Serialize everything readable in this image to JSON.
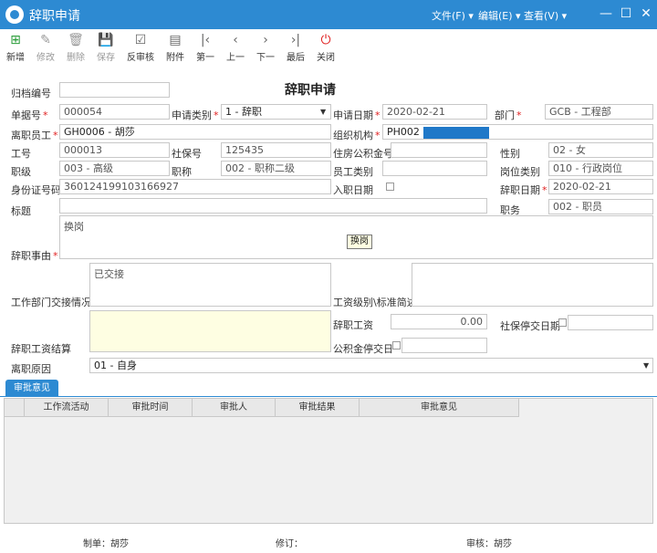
{
  "window": {
    "title": "辞职申请"
  },
  "menus": {
    "file": "文件(F)",
    "edit": "编辑(E)",
    "view": "查看(V)"
  },
  "toolbar": {
    "new": "新增",
    "edit": "修改",
    "delete": "删除",
    "save": "保存",
    "review": "反审核",
    "attach": "附件",
    "first": "第一",
    "prev": "上一",
    "next": "下一",
    "last": "最后",
    "close": "关闭"
  },
  "form": {
    "title": "辞职申请",
    "archive_no": {
      "label": "归档编号",
      "value": ""
    },
    "doc_no": {
      "label": "单据号",
      "value": "000054"
    },
    "apply_type": {
      "label": "申请类别",
      "value": "1 - 辞职"
    },
    "apply_date": {
      "label": "申请日期",
      "value": "2020-02-21"
    },
    "dept": {
      "label": "部门",
      "value": "GCB - 工程部"
    },
    "employee": {
      "label": "离职员工",
      "value": "GH0006 - 胡莎"
    },
    "org": {
      "label": "组织机构",
      "value": "PH002"
    },
    "emp_no": {
      "label": "工号",
      "value": "000013"
    },
    "social_no": {
      "label": "社保号",
      "value": "125435"
    },
    "housing_no": {
      "label": "住房公积金号",
      "value": ""
    },
    "gender": {
      "label": "性别",
      "value": "02 - 女"
    },
    "rank": {
      "label": "职级",
      "value": "003 - 高级"
    },
    "title_rank": {
      "label": "职称",
      "value": "002 - 职称二级"
    },
    "emp_category": {
      "label": "员工类别",
      "value": ""
    },
    "post_category": {
      "label": "岗位类别",
      "value": "010 - 行政岗位"
    },
    "id_card": {
      "label": "身份证号码",
      "value": "360124199103166927"
    },
    "entry_date": {
      "label": "入职日期",
      "value": ""
    },
    "resign_date": {
      "label": "辞职日期",
      "value": "2020-02-21"
    },
    "subject": {
      "label": "标题",
      "value": ""
    },
    "position": {
      "label": "职务",
      "value": "002 - 职员"
    },
    "reason": {
      "label": "辞职事由",
      "value": "换岗"
    },
    "tooltip": "换岗",
    "handover": {
      "label": "工作部门交接情况",
      "value": "已交接"
    },
    "salary_std": {
      "label": "工资级别\\标准简述",
      "value": ""
    },
    "resign_salary": {
      "label": "辞职工资",
      "value": "0.00"
    },
    "social_stop": {
      "label": "社保停交日期",
      "value": ""
    },
    "salary_settle": {
      "label": "辞职工资结算",
      "value": ""
    },
    "housing_stop": {
      "label": "公积金停交日",
      "value": ""
    },
    "leave_reason": {
      "label": "离职原因",
      "value": "01 - 自身"
    }
  },
  "approval": {
    "tab": "审批意见",
    "columns": [
      "工作流活动",
      "审批时间",
      "审批人",
      "审批结果",
      "审批意见"
    ]
  },
  "footer": {
    "maker": "制单：胡莎",
    "revise": "修订：",
    "auditor": "审核：胡莎"
  },
  "colors": {
    "accent": "#2d8ad2",
    "required": "#e02020",
    "highlight": "#fefee2"
  }
}
